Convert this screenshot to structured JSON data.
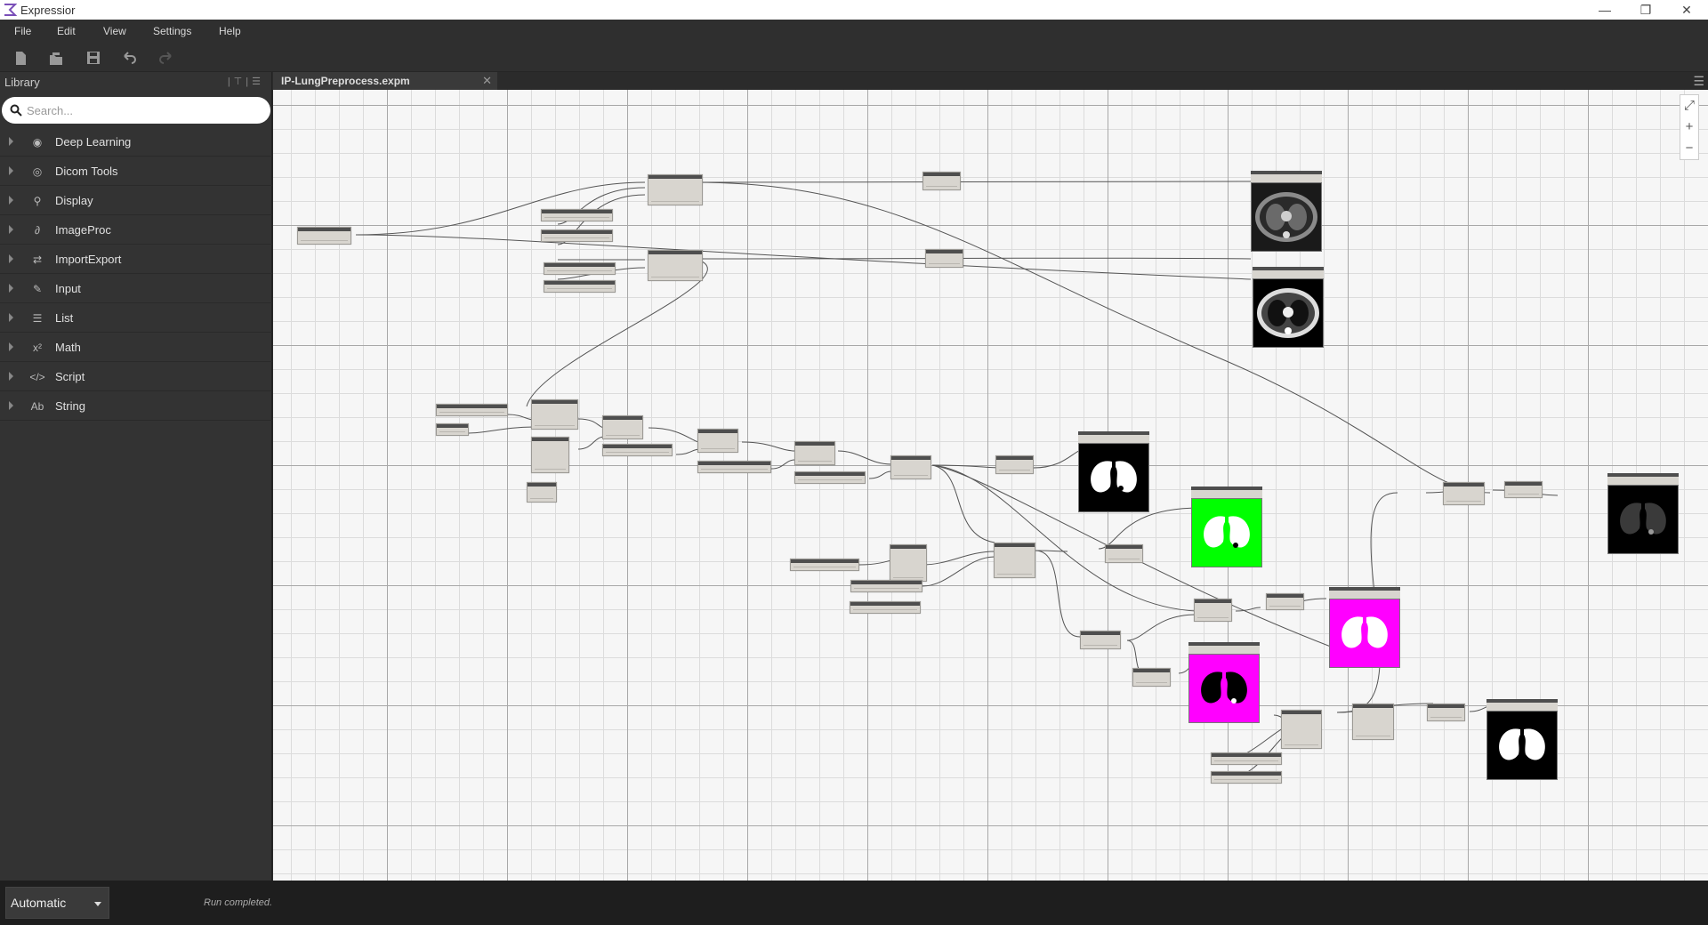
{
  "app": {
    "title": "Expressior"
  },
  "window_controls": [
    "—",
    "❐",
    "✕"
  ],
  "menu": [
    "File",
    "Edit",
    "View",
    "Settings",
    "Help"
  ],
  "toolbar": [
    "new-file-icon",
    "open-file-icon",
    "save-icon",
    "undo-icon",
    "redo-icon"
  ],
  "library": {
    "header": "Library",
    "search_placeholder": "Search...",
    "items": [
      {
        "label": "Deep Learning",
        "icon": "brain-icon",
        "glyph": "◉"
      },
      {
        "label": "Dicom Tools",
        "icon": "disc-icon",
        "glyph": "◎"
      },
      {
        "label": "Display",
        "icon": "magnifier-icon",
        "glyph": "⚲"
      },
      {
        "label": "ImageProc",
        "icon": "wand-icon",
        "glyph": "∂"
      },
      {
        "label": "ImportExport",
        "icon": "swap-icon",
        "glyph": "⇄"
      },
      {
        "label": "Input",
        "icon": "pencil-icon",
        "glyph": "✎"
      },
      {
        "label": "List",
        "icon": "list-icon",
        "glyph": "☰"
      },
      {
        "label": "Math",
        "icon": "power-icon",
        "glyph": "x²"
      },
      {
        "label": "Script",
        "icon": "code-icon",
        "glyph": "</>"
      },
      {
        "label": "String",
        "icon": "text-icon",
        "glyph": "Ab"
      }
    ]
  },
  "tab": {
    "label": "IP-LungPreprocess.expm"
  },
  "canvas": {
    "zoom_controls": [
      "⤢",
      "+",
      "−"
    ]
  },
  "footer": {
    "run_mode": "Automatic",
    "status": "Run completed."
  },
  "colors": {
    "preview_green": "#00ff00",
    "preview_magenta": "#ff00ff",
    "node_header": "#4e4e4e",
    "node_body": "#d8d5cf"
  }
}
